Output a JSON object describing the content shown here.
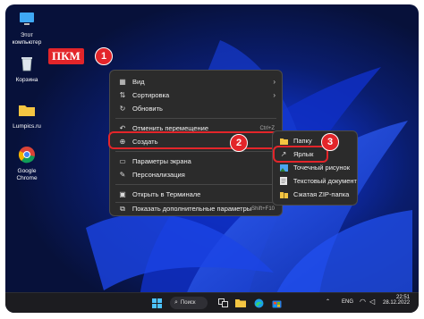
{
  "desktop_icons": [
    {
      "name": "this-pc",
      "label_line1": "Этот",
      "label_line2": "компьютер"
    },
    {
      "name": "recycle-bin",
      "label_line1": "Корзина",
      "label_line2": ""
    },
    {
      "name": "folder",
      "label_line1": "Lumpics.ru",
      "label_line2": ""
    },
    {
      "name": "chrome",
      "label_line1": "Google",
      "label_line2": "Chrome"
    }
  ],
  "callouts": {
    "rmb_label": "ПКМ",
    "step1": "1",
    "step2": "2",
    "step3": "3"
  },
  "context_menu": {
    "items": [
      {
        "label": "Вид",
        "shortcut": "",
        "arrow": "›"
      },
      {
        "label": "Сортировка",
        "shortcut": "",
        "arrow": "›"
      },
      {
        "label": "Обновить",
        "shortcut": "",
        "arrow": ""
      },
      {
        "label": "Отменить перемещение",
        "shortcut": "Ctrl+Z",
        "arrow": ""
      },
      {
        "label": "Создать",
        "shortcut": "",
        "arrow": "›"
      },
      {
        "label": "Параметры экрана",
        "shortcut": "",
        "arrow": ""
      },
      {
        "label": "Персонализация",
        "shortcut": "",
        "arrow": ""
      },
      {
        "label": "Открыть в Терминале",
        "shortcut": "",
        "arrow": ""
      },
      {
        "label": "Показать дополнительные параметры",
        "shortcut": "Shift+F10",
        "arrow": ""
      }
    ]
  },
  "submenu": {
    "items": [
      {
        "label": "Папку"
      },
      {
        "label": "Ярлык"
      },
      {
        "label": "Точечный рисунок"
      },
      {
        "label": "Текстовый документ"
      },
      {
        "label": "Сжатая ZIP-папка"
      }
    ]
  },
  "taskbar": {
    "search_label": "Поиск",
    "lang": "ENG",
    "time": "22:51",
    "date": "28.12.2022"
  },
  "colors": {
    "accent": "#e3252a",
    "menu_bg": "#2b2b2b",
    "taskbar_bg": "#1c1c20"
  }
}
